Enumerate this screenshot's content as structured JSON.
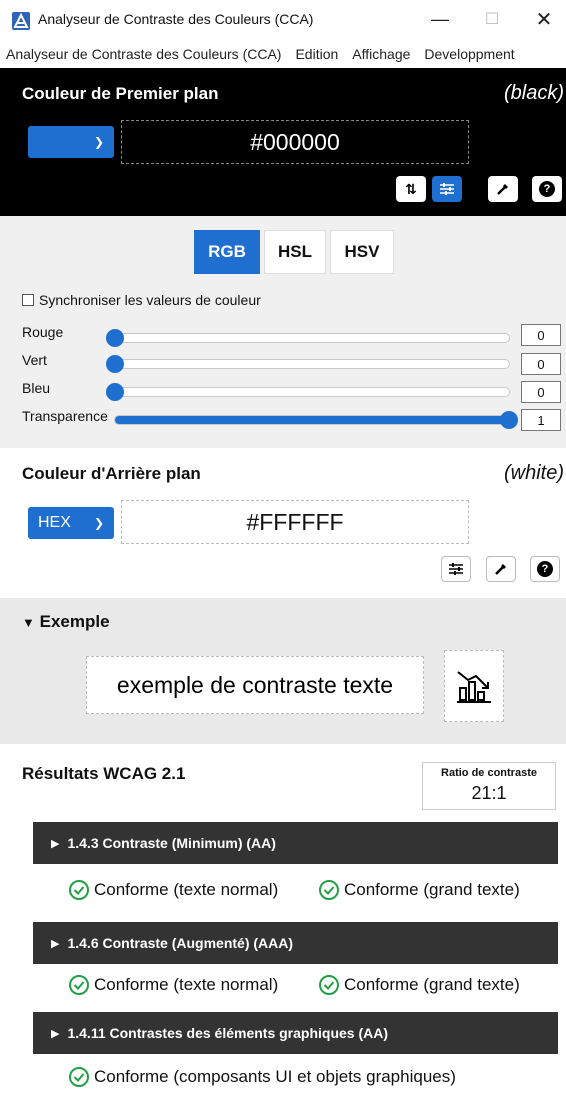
{
  "window": {
    "title": "Analyseur de Contraste des Couleurs (CCA)",
    "minimize": "—",
    "maximize": "☐",
    "close": "✕"
  },
  "menu": {
    "items": [
      "Analyseur de Contraste des Couleurs (CCA)",
      "Edition",
      "Affichage",
      "Developpment"
    ]
  },
  "foreground": {
    "title": "Couleur de Premier plan",
    "color_name": "(black)",
    "hex_value": "#000000",
    "format_selected": "",
    "icons": [
      "swap-icon",
      "sliders-icon",
      "eyedropper-icon",
      "help-icon"
    ]
  },
  "controls": {
    "tabs": [
      "RGB",
      "HSL",
      "HSV"
    ],
    "active_tab": "RGB",
    "sync_label": "Synchroniser les valeurs de couleur",
    "sliders": [
      {
        "label": "Rouge",
        "value": "0",
        "fraction": 0.0
      },
      {
        "label": "Vert",
        "value": "0",
        "fraction": 0.0
      },
      {
        "label": "Bleu",
        "value": "0",
        "fraction": 0.0
      },
      {
        "label": "Transparence",
        "value": "1",
        "fraction": 1.0
      }
    ]
  },
  "background": {
    "title": "Couleur d'Arrière plan",
    "color_name": "(white)",
    "format_selected": "HEX",
    "hex_value": "#FFFFFF",
    "icons": [
      "sliders-icon",
      "eyedropper-icon",
      "help-icon"
    ]
  },
  "example": {
    "title": "Exemple",
    "toggle": "▼",
    "sample_text": "exemple de contraste texte",
    "chart_icon": "chart-icon"
  },
  "results": {
    "title": "Résultats WCAG 2.1",
    "ratio_label": "Ratio de contraste",
    "ratio_value": "21:1",
    "criteria": [
      {
        "title": "1.4.3 Contraste (Minimum) (AA)",
        "results": [
          "Conforme (texte normal)",
          "Conforme (grand texte)"
        ]
      },
      {
        "title": "1.4.6 Contraste (Augmenté) (AAA)",
        "results": [
          "Conforme (texte normal)",
          "Conforme (grand texte)"
        ]
      },
      {
        "title": "1.4.11 Contrastes des éléments graphiques (AA)",
        "results": [
          "Conforme (composants UI et objets graphiques)"
        ]
      }
    ]
  },
  "colors": {
    "accent": "#1f6fd1",
    "pass": "#22a045",
    "header_dark": "#333333"
  }
}
